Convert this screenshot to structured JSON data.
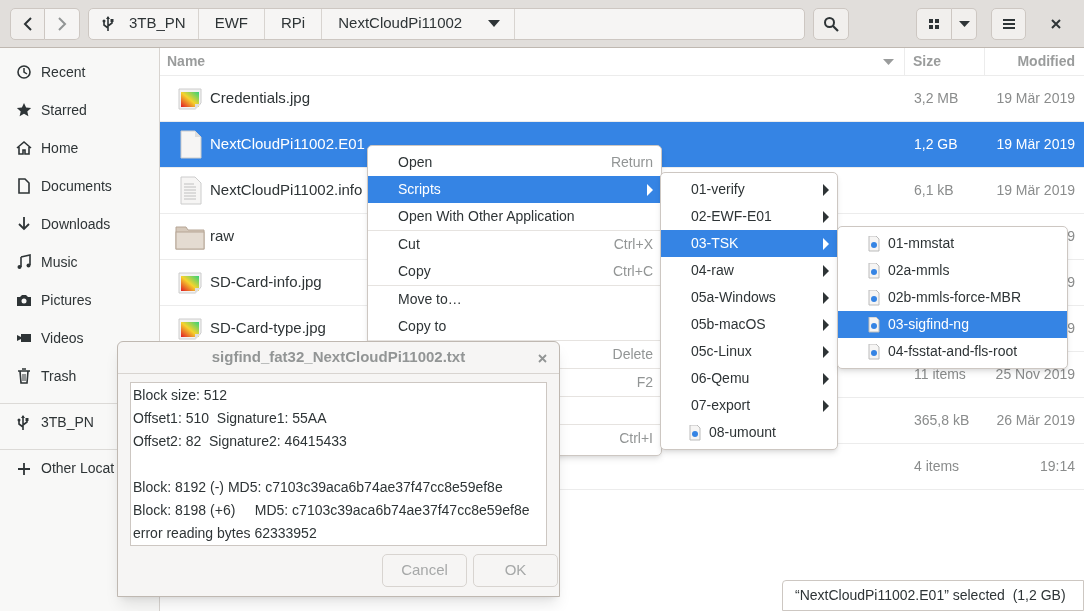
{
  "path": [
    {
      "label": "3TB_PN",
      "kind": "drive"
    },
    {
      "label": "EWF",
      "kind": "folder"
    },
    {
      "label": "RPi",
      "kind": "folder"
    },
    {
      "label": "NextCloudPi11002",
      "kind": "current"
    }
  ],
  "sidebar": {
    "items": [
      {
        "label": "Recent",
        "kind": "recent",
        "separator_before": false
      },
      {
        "label": "Starred",
        "kind": "starred",
        "separator_before": false
      },
      {
        "label": "Home",
        "kind": "home",
        "separator_before": false
      },
      {
        "label": "Documents",
        "kind": "documents",
        "separator_before": false
      },
      {
        "label": "Downloads",
        "kind": "downloads",
        "separator_before": false
      },
      {
        "label": "Music",
        "kind": "music",
        "separator_before": false
      },
      {
        "label": "Pictures",
        "kind": "pictures",
        "separator_before": false
      },
      {
        "label": "Videos",
        "kind": "videos",
        "separator_before": false
      },
      {
        "label": "Trash",
        "kind": "trash",
        "separator_before": false
      },
      {
        "label": "3TB_PN",
        "kind": "drive",
        "separator_before": true
      },
      {
        "label": "Other Locat",
        "kind": "other",
        "separator_before": true
      }
    ]
  },
  "columns": [
    {
      "label": "Name",
      "sorted": true
    },
    {
      "label": "Size",
      "sorted": false
    },
    {
      "label": "Modified",
      "sorted": false
    }
  ],
  "files": [
    {
      "name": "Credentials.jpg",
      "kind": "image",
      "size": "3,2 MB",
      "modified": "19 Mär 2019",
      "selected": false
    },
    {
      "name": "NextCloudPi11002.E01",
      "kind": "file",
      "size": "1,2 GB",
      "modified": "19 Mär 2019",
      "selected": true
    },
    {
      "name": "NextCloudPi11002.info",
      "kind": "text",
      "size": "6,1 kB",
      "modified": "19 Mär 2019",
      "selected": false
    },
    {
      "name": "raw",
      "kind": "folder",
      "modified": "9",
      "selected": false
    },
    {
      "name": "SD-Card-info.jpg",
      "kind": "image",
      "modified": "9",
      "selected": false
    },
    {
      "name": "SD-Card-type.jpg",
      "kind": "image",
      "modified": "9",
      "selected": false
    },
    {
      "kind": "hidden",
      "size": "11 items",
      "modified": "25 Nov 2019",
      "selected": false
    },
    {
      "kind": "hidden",
      "size": "365,8 kB",
      "modified": "26 Mär 2019",
      "selected": false
    },
    {
      "kind": "hidden",
      "size": "4 items",
      "modified": "19:14",
      "selected": false
    }
  ],
  "context_menu": {
    "items": [
      {
        "label": "Open",
        "shortcut": "Return",
        "submenu": false,
        "selected": false,
        "separator_after": false
      },
      {
        "label": "Scripts",
        "submenu": true,
        "selected": true,
        "separator_after": false
      },
      {
        "label": "Open With Other Application",
        "submenu": false,
        "selected": false,
        "separator_after": true
      },
      {
        "label": "Cut",
        "shortcut": "Ctrl+X",
        "submenu": false,
        "selected": false,
        "separator_after": false
      },
      {
        "label": "Copy",
        "shortcut": "Ctrl+C",
        "submenu": false,
        "selected": false,
        "separator_after": true
      },
      {
        "label": "Move to…",
        "submenu": false,
        "selected": false,
        "separator_after": false
      },
      {
        "label": "Copy to",
        "submenu": false,
        "selected": false,
        "separator_after": true
      },
      {
        "shortcut": "Delete",
        "submenu": false,
        "selected": false,
        "separator_after": true
      },
      {
        "shortcut": "F2",
        "submenu": false,
        "selected": false,
        "separator_after": true
      },
      {
        "submenu": false,
        "selected": false,
        "separator_after": true
      },
      {
        "shortcut": "Ctrl+I",
        "submenu": false,
        "selected": false,
        "separator_after": false
      }
    ]
  },
  "scripts_menu": {
    "items": [
      {
        "label": "01-verify",
        "kind": "folder",
        "selected": false
      },
      {
        "label": "02-EWF-E01",
        "kind": "folder",
        "selected": false
      },
      {
        "label": "03-TSK",
        "kind": "folder",
        "selected": true
      },
      {
        "label": "04-raw",
        "kind": "folder",
        "selected": false
      },
      {
        "label": "05a-Windows",
        "kind": "folder",
        "selected": false
      },
      {
        "label": "05b-macOS",
        "kind": "folder",
        "selected": false
      },
      {
        "label": "05c-Linux",
        "kind": "folder",
        "selected": false
      },
      {
        "label": "06-Qemu",
        "kind": "folder",
        "selected": false
      },
      {
        "label": "07-export",
        "kind": "folder",
        "selected": false
      },
      {
        "label": "08-umount",
        "kind": "script",
        "selected": false
      }
    ]
  },
  "tsk_menu": {
    "items": [
      {
        "label": "01-mmstat",
        "kind": "script",
        "selected": false
      },
      {
        "label": "02a-mmls",
        "kind": "script",
        "selected": false
      },
      {
        "label": "02b-mmls-force-MBR",
        "kind": "script",
        "selected": false
      },
      {
        "label": "03-sigfind-ng",
        "kind": "script",
        "selected": true
      },
      {
        "label": "04-fsstat-and-fls-root",
        "kind": "script",
        "selected": false
      }
    ]
  },
  "dialog": {
    "title": "sigfind_fat32_NextCloudPi11002.txt",
    "paragraphs": [
      [
        "Block size: 512",
        "Offset1: 510  Signature1: 55AA",
        "Offset2: 82  Signature2: 46415433"
      ],
      [
        "Block: 8192 (-) MD5: c7103c39aca6b74ae37f47cc8e59ef8e",
        "Block: 8198 (+6)     MD5: c7103c39aca6b74ae37f47cc8e59ef8e",
        "error reading bytes 62333952"
      ]
    ],
    "buttons": [
      {
        "label": "Cancel",
        "disabled": true
      },
      {
        "label": "OK",
        "disabled": true
      }
    ]
  },
  "status_bar": {
    "text": "“NextCloudPi11002.E01” selected  (1,2 GB)"
  }
}
